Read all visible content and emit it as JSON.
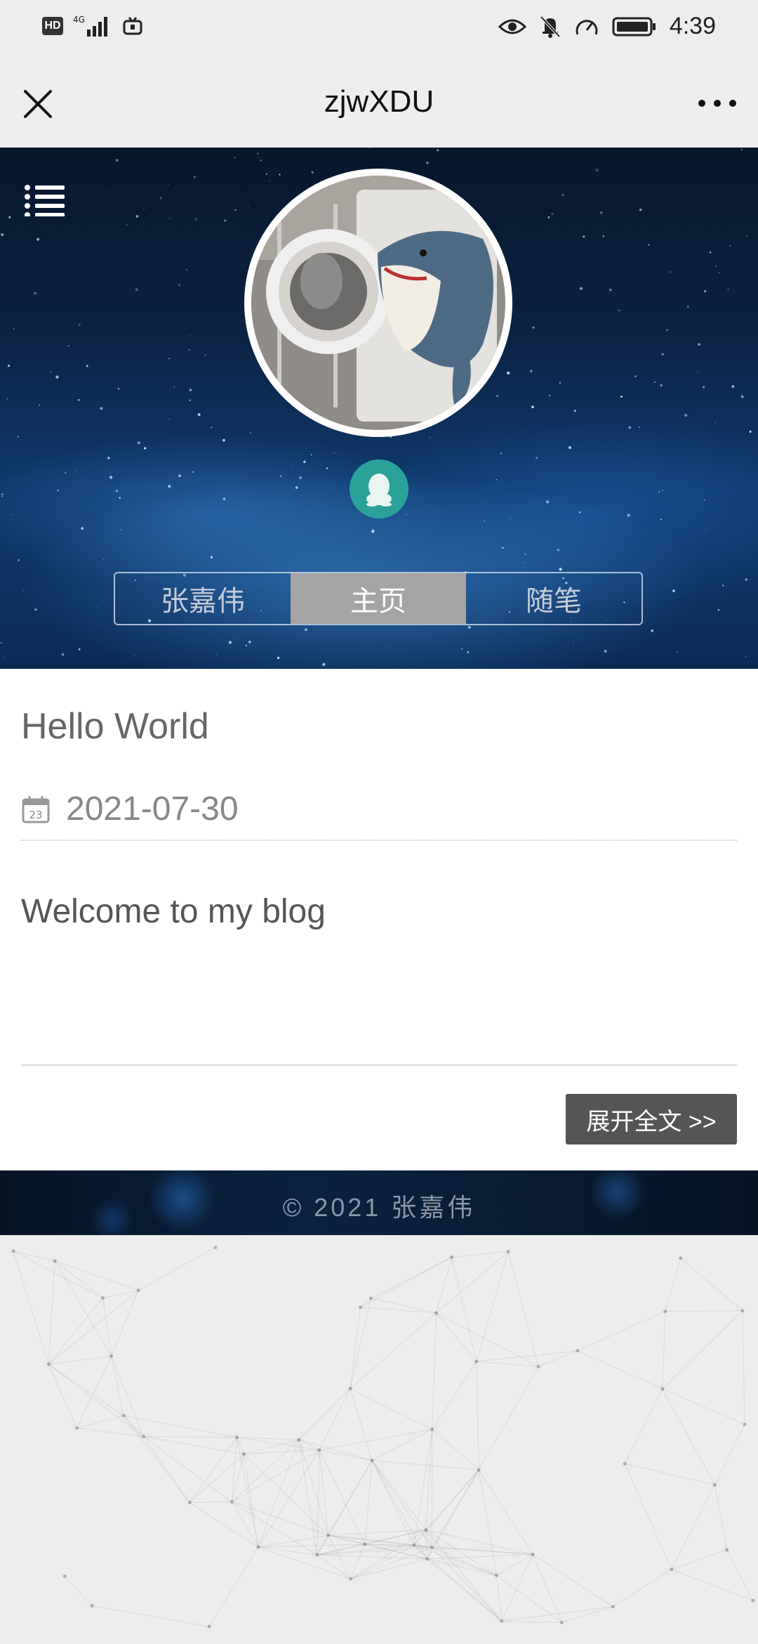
{
  "status_bar": {
    "left_badges": [
      "HD",
      "4G"
    ],
    "time": "4:39",
    "icons": [
      "hd-icon",
      "signal-icon",
      "tv-icon",
      "eye-icon",
      "mute-bell-icon",
      "speed-icon",
      "battery-icon"
    ]
  },
  "nav": {
    "title": "zjwXDU",
    "close_icon": "close-icon",
    "more_icon": "more-icon"
  },
  "hero": {
    "menu_icon": "list-menu-icon",
    "avatar_alt": "avatar",
    "qq_icon": "qq-icon",
    "tabs": [
      {
        "label": "张嘉伟",
        "active": false
      },
      {
        "label": "主页",
        "active": true
      },
      {
        "label": "随笔",
        "active": false
      }
    ]
  },
  "post": {
    "title": "Hello World",
    "date": "2021-07-30",
    "calendar_day": "23",
    "body": "Welcome to my blog",
    "expand_label": "展开全文 >>"
  },
  "footer": {
    "text": "© 2021 张嘉伟"
  },
  "colors": {
    "tab_active_bg": "#a5a5a5",
    "expand_button_bg": "#555555",
    "qq_badge_bg": "#2aa199",
    "hero_base": "#0b2242"
  }
}
